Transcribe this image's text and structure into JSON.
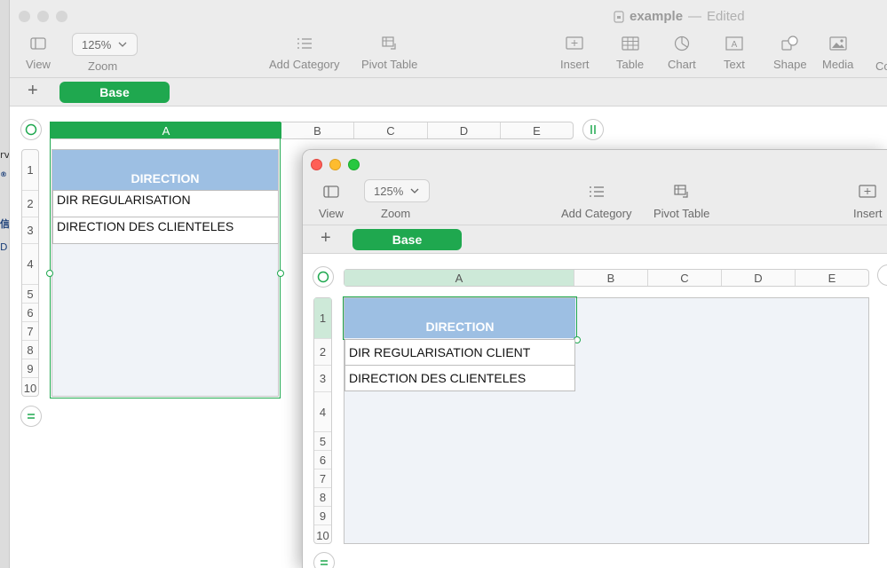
{
  "back_window": {
    "title": "example",
    "title_separator": "—",
    "title_status": "Edited",
    "zoom_value": "125%",
    "toolbar": {
      "view": "View",
      "zoom": "Zoom",
      "add_category": "Add Category",
      "pivot_table": "Pivot Table",
      "insert": "Insert",
      "table": "Table",
      "chart": "Chart",
      "text": "Text",
      "shape": "Shape",
      "media": "Media",
      "cut_off": "Co"
    },
    "sheet_tab": "Base",
    "columns": [
      "A",
      "B",
      "C",
      "D",
      "E"
    ],
    "rows": [
      "1",
      "2",
      "3",
      "4",
      "5",
      "6",
      "7",
      "8",
      "9",
      "10"
    ],
    "cells": {
      "header": "DIRECTION",
      "r2": "DIR REGULARISATION",
      "r3": "DIRECTION DES CLIENTELES"
    }
  },
  "front_window": {
    "zoom_value": "125%",
    "toolbar": {
      "view": "View",
      "zoom": "Zoom",
      "add_category": "Add Category",
      "pivot_table": "Pivot Table",
      "insert": "Insert"
    },
    "sheet_tab": "Base",
    "columns": [
      "A",
      "B",
      "C",
      "D",
      "E"
    ],
    "rows": [
      "1",
      "2",
      "3",
      "4",
      "5",
      "6",
      "7",
      "8",
      "9",
      "10"
    ],
    "cells": {
      "header": "DIRECTION",
      "r2": "DIR REGULARISATION CLIENT",
      "r3": "DIRECTION DES CLIENTELES"
    }
  },
  "desktop_glyphs": [
    "rv",
    "®",
    "信",
    "D"
  ],
  "colors": {
    "accent_green": "#1fa84f",
    "header_blue": "#9dbfe3",
    "close_red": "#ff5f57",
    "min_yellow": "#febc2e",
    "max_green": "#28c840"
  }
}
